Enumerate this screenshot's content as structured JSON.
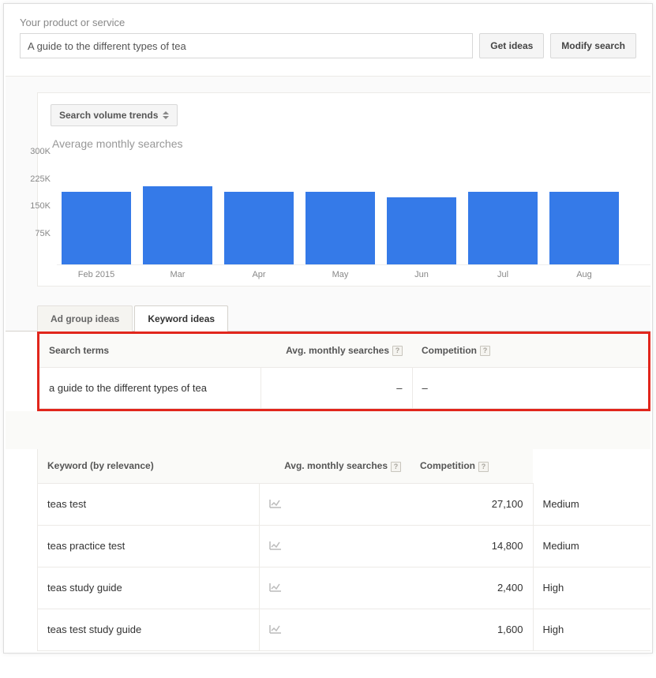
{
  "search": {
    "label": "Your product or service",
    "value": "A guide to the different types of tea",
    "get_ideas": "Get ideas",
    "modify_search": "Modify search"
  },
  "chart_panel": {
    "dropdown_label": "Search volume trends",
    "title": "Average monthly searches"
  },
  "chart_data": {
    "type": "bar",
    "title": "Average monthly searches",
    "xlabel": "",
    "ylabel": "",
    "ylim": [
      0,
      300000
    ],
    "y_ticks": [
      "300K",
      "225K",
      "150K",
      "75K"
    ],
    "categories": [
      "Feb 2015",
      "Mar",
      "Apr",
      "May",
      "Jun",
      "Jul",
      "Aug"
    ],
    "values": [
      195000,
      210000,
      195000,
      195000,
      180000,
      195000,
      195000
    ]
  },
  "tabs": {
    "ad_group": "Ad group ideas",
    "keyword": "Keyword ideas"
  },
  "table1": {
    "headers": {
      "search_terms": "Search terms",
      "avg_monthly": "Avg. monthly searches",
      "competition": "Competition"
    },
    "row": {
      "term": "a guide to the different types of tea",
      "avg": "–",
      "competition": "–"
    }
  },
  "table2": {
    "headers": {
      "keyword": "Keyword (by relevance)",
      "avg_monthly": "Avg. monthly searches",
      "competition": "Competition"
    },
    "rows": [
      {
        "keyword": "teas test",
        "avg": "27,100",
        "competition": "Medium"
      },
      {
        "keyword": "teas practice test",
        "avg": "14,800",
        "competition": "Medium"
      },
      {
        "keyword": "teas study guide",
        "avg": "2,400",
        "competition": "High"
      },
      {
        "keyword": "teas test study guide",
        "avg": "1,600",
        "competition": "High"
      }
    ]
  },
  "help_glyph": "?"
}
